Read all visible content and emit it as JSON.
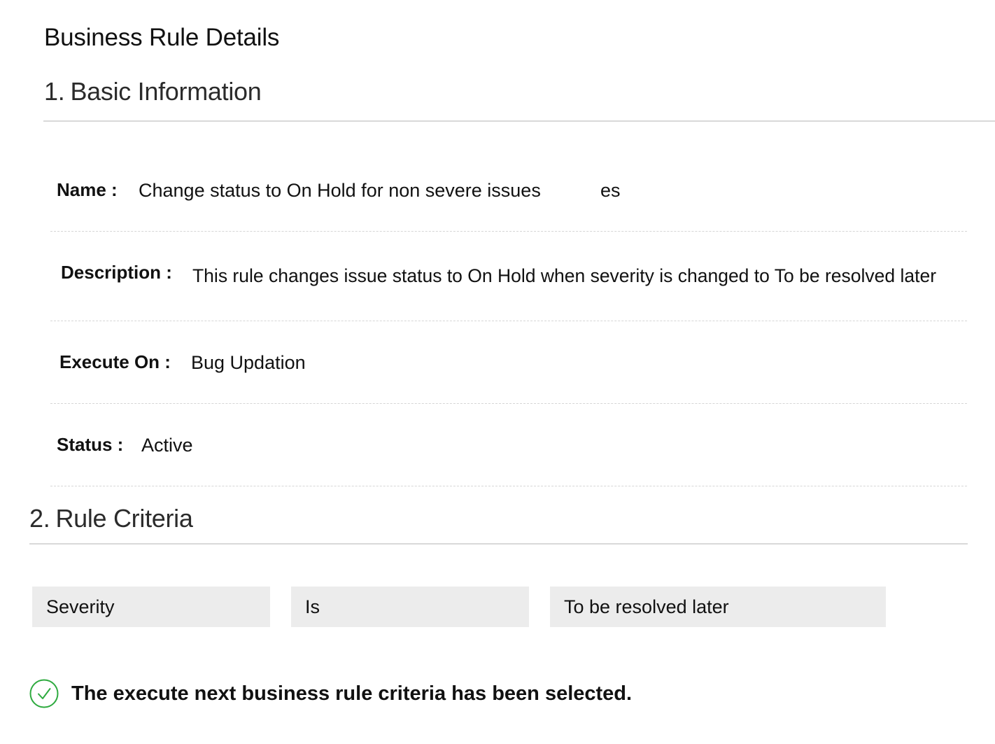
{
  "page": {
    "title": "Business Rule Details"
  },
  "basic_information": {
    "number": "1.",
    "heading": "Basic Information",
    "fields": {
      "name": {
        "label": "Name :",
        "value": "Change status to On Hold for non severe issues",
        "trailing_fragment": "es"
      },
      "description": {
        "label": "Description :",
        "value": "This rule changes issue status to On Hold when severity is changed to To be resolved later"
      },
      "execute_on": {
        "label": "Execute On :",
        "value": "Bug Updation"
      },
      "status": {
        "label": "Status :",
        "value": "Active"
      }
    }
  },
  "rule_criteria": {
    "number": "2.",
    "heading": "Rule Criteria",
    "criteria": {
      "field": "Severity",
      "operator": "Is",
      "value": "To be resolved later"
    }
  },
  "notice": {
    "icon": "check-circle-icon",
    "text": "The execute next business rule criteria has been selected.",
    "icon_color": "#2eaa3f"
  }
}
